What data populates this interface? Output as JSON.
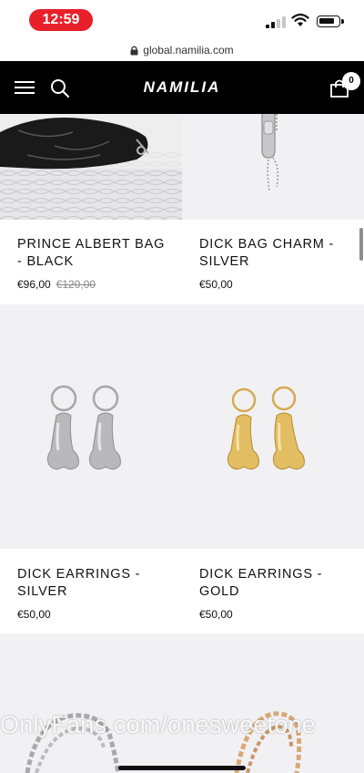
{
  "status_bar": {
    "time": "12:59"
  },
  "browser": {
    "url": "global.namilia.com"
  },
  "header": {
    "logo": "NAMILIA",
    "cart_count": "0"
  },
  "products": [
    {
      "name": "PRINCE ALBERT BAG - BLACK",
      "price": "€96,00",
      "old_price": "€120,00"
    },
    {
      "name": "DICK BAG CHARM - SILVER",
      "price": "€50,00"
    },
    {
      "name": "DICK EARRINGS - SILVER",
      "price": "€50,00"
    },
    {
      "name": "DICK EARRINGS - GOLD",
      "price": "€50,00"
    }
  ],
  "watermark": "OnlyFans.com/onesweetone",
  "colors": {
    "status_pill": "#e8202a",
    "header_bg": "#000000",
    "gold": "#d9b25a",
    "silver": "#b9b9bb"
  }
}
